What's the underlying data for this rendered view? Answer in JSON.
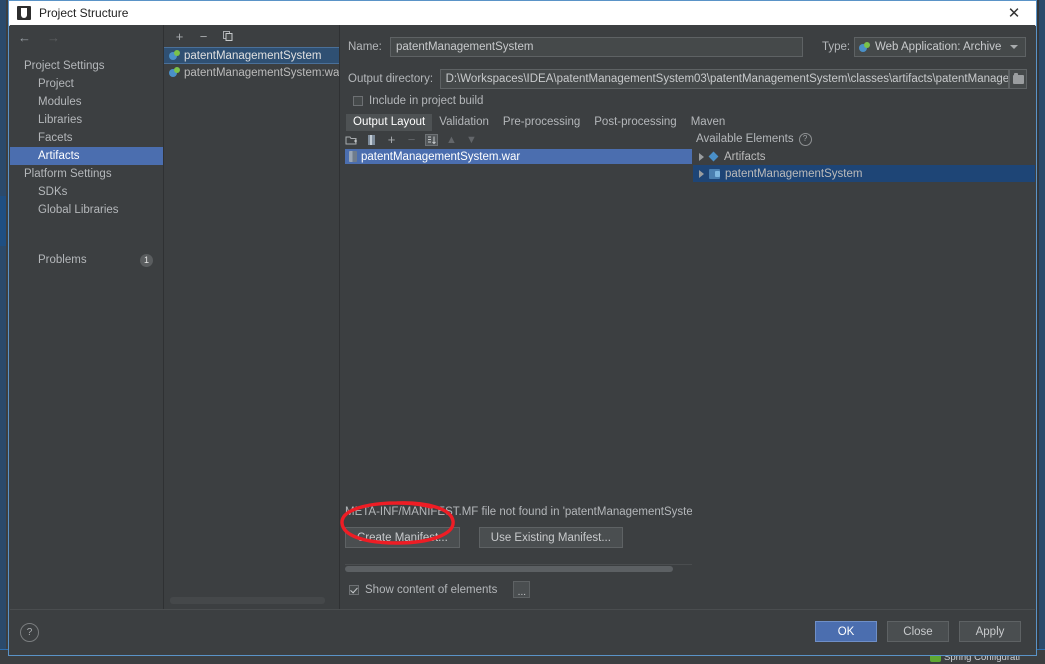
{
  "window": {
    "title": "Project Structure",
    "close_label": "✕",
    "app_icon": "intellij-idea-icon"
  },
  "nav": {
    "back_label": "←",
    "forward_label": "→",
    "groups": [
      {
        "label": "Project Settings",
        "items": [
          "Project",
          "Modules",
          "Libraries",
          "Facets",
          "Artifacts"
        ]
      },
      {
        "label": "Platform Settings",
        "items": [
          "SDKs",
          "Global Libraries"
        ]
      }
    ],
    "selected": "Artifacts",
    "problems_label": "Problems",
    "problems_count": "1"
  },
  "artifacts": {
    "toolbar": {
      "add": "+",
      "remove": "−",
      "copy": "copy-icon"
    },
    "items": [
      {
        "label": "patentManagementSystem",
        "selected": true
      },
      {
        "label": "patentManagementSystem:war exp",
        "selected": false
      }
    ]
  },
  "details": {
    "name_label": "Name:",
    "name_value": "patentManagementSystem",
    "type_label": "Type:",
    "type_value": "Web Application: Archive",
    "output_dir_label": "Output directory:",
    "output_dir_value": "D:\\Workspaces\\IDEA\\patentManagementSystem03\\patentManagementSystem\\classes\\artifacts\\patentManagementSystem",
    "include_label": "Include in project build",
    "include_checked": false,
    "tabs": [
      {
        "label": "Output Layout",
        "active": true
      },
      {
        "label": "Validation",
        "active": false
      },
      {
        "label": "Pre-processing",
        "active": false
      },
      {
        "label": "Post-processing",
        "active": false
      },
      {
        "label": "Maven",
        "active": false
      }
    ]
  },
  "output_layout": {
    "toolbar_icons": [
      "add-directory-icon",
      "add-archive-icon",
      "add-copy-icon",
      "remove-icon",
      "sort-icon",
      "move-up-icon",
      "move-down-icon"
    ],
    "tree": [
      {
        "label": "patentManagementSystem.war",
        "selected": true,
        "icon": "archive-icon"
      }
    ],
    "available_header": "Available Elements",
    "available_help": "?",
    "available": [
      {
        "label": "Artifacts",
        "icon": "artifact-icon",
        "expandable": true,
        "selected": false
      },
      {
        "label": "patentManagementSystem",
        "icon": "module-icon",
        "expandable": true,
        "selected": true
      }
    ],
    "manifest_message": "META-INF/MANIFEST.MF file not found in 'patentManagementSystem_war.w",
    "create_manifest_button": "Create Manifest...",
    "use_existing_manifest_button": "Use Existing Manifest...",
    "show_content_label": "Show content of elements",
    "show_content_checked": true,
    "more_button": "..."
  },
  "footer": {
    "help": "?",
    "ok": "OK",
    "close": "Close",
    "apply": "Apply"
  },
  "taskbar": {
    "item": "Spring Configurati"
  },
  "colors": {
    "accent_selected": "#4b6eaf",
    "dialog_bg": "#3c3f41",
    "field_bg": "#45494a",
    "annotation_red": "#ee1d25"
  }
}
